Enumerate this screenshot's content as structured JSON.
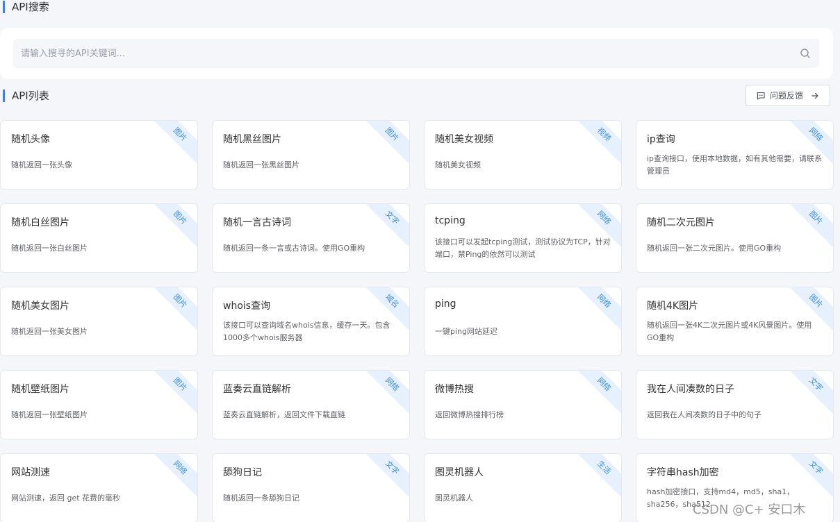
{
  "search_section": {
    "title": "API搜索",
    "placeholder": "请输入搜寻的API关键词..."
  },
  "list_section": {
    "title": "API列表",
    "feedback_label": "问题反馈"
  },
  "cards": [
    {
      "title": "随机头像",
      "tag": "图片",
      "desc": "随机返回一张头像"
    },
    {
      "title": "随机黑丝图片",
      "tag": "图片",
      "desc": "随机返回一张黑丝图片"
    },
    {
      "title": "随机美女视频",
      "tag": "视频",
      "desc": "随机美女视频"
    },
    {
      "title": "ip查询",
      "tag": "网络",
      "desc": "ip查询接口，使用本地数据，如有其他需要，请联系管理员"
    },
    {
      "title": "随机白丝图片",
      "tag": "图片",
      "desc": "随机返回一张白丝图片"
    },
    {
      "title": "随机一言古诗词",
      "tag": "文字",
      "desc": "随机返回一条一言或古诗词。使用GO重构"
    },
    {
      "title": "tcping",
      "tag": "网络",
      "desc": "该接口可以发起tcping测试，测试协议为TCP，针对端口，禁Ping的依然可以测试"
    },
    {
      "title": "随机二次元图片",
      "tag": "图片",
      "desc": "随机返回一张二次元图片。使用GO重构"
    },
    {
      "title": "随机美女图片",
      "tag": "图片",
      "desc": "随机返回一张美女图片"
    },
    {
      "title": "whois查询",
      "tag": "域名",
      "desc": "该接口可以查询域名whois信息，缓存一天。包含1000多个whois服务器"
    },
    {
      "title": "ping",
      "tag": "网络",
      "desc": "一键ping网站延迟"
    },
    {
      "title": "随机4K图片",
      "tag": "图片",
      "desc": "随机返回一张4K二次元图片或4K风景图片。使用GO重构"
    },
    {
      "title": "随机壁纸图片",
      "tag": "图片",
      "desc": "随机返回一张壁纸图片"
    },
    {
      "title": "蓝奏云直链解析",
      "tag": "网络",
      "desc": "蓝奏云直链解析，返回文件下载直链"
    },
    {
      "title": "微博热搜",
      "tag": "网络",
      "desc": "返回微博热搜排行榜"
    },
    {
      "title": "我在人间凑数的日子",
      "tag": "文字",
      "desc": "返回我在人间凑数的日子中的句子"
    },
    {
      "title": "网站测速",
      "tag": "网络",
      "desc": "网站测速，返回 get 花费的毫秒"
    },
    {
      "title": "舔狗日记",
      "tag": "文字",
      "desc": "随机返回一条舔狗日记"
    },
    {
      "title": "图灵机器人",
      "tag": "生活",
      "desc": "图灵机器人"
    },
    {
      "title": "字符串hash加密",
      "tag": "文字",
      "desc": "hash加密接口，支持md4，md5，sha1，sha256，sha512"
    }
  ],
  "watermark": "CSDN @C+  安口木",
  "colors": {
    "accent": "#3b82f6",
    "tag_bg": "#e6f1fd",
    "tag_text": "#3b8ff0",
    "page_bg": "#f4f6fa"
  }
}
